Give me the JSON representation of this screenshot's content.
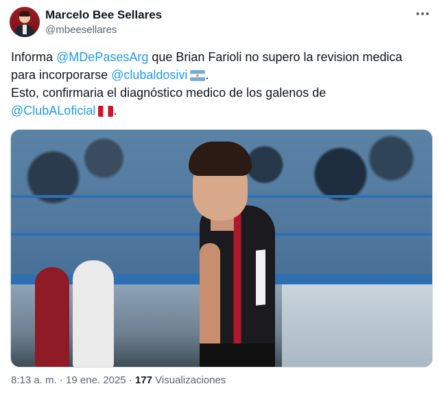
{
  "author": {
    "display_name": "Marcelo Bee Sellares",
    "handle": "@mbeesellares"
  },
  "tweet": {
    "line1_prefix": "Informa ",
    "mention1": "@MDePasesArg",
    "line1_suffix": " que Brian Farioli no supero la revision medica",
    "line2_prefix": "para incorporarse ",
    "mention2": "@clubaldosivi",
    "line2_suffix": ".",
    "line3": "Esto, confirmaria el diagnóstico medico de los galenos de",
    "mention3": "@ClubALoficial",
    "line4_suffix": ".",
    "flag1": "argentina-flag",
    "flag2": "peru-flag"
  },
  "media": {
    "description_icon": "photo"
  },
  "meta": {
    "time": "8:13 a. m.",
    "sep1": " · ",
    "date": "19 ene. 2025",
    "sep2": " · ",
    "views_count": "177",
    "views_label": " Visualizaciones"
  },
  "colors": {
    "link": "#1d9bf0",
    "text": "#0f1419",
    "muted": "#536471"
  }
}
